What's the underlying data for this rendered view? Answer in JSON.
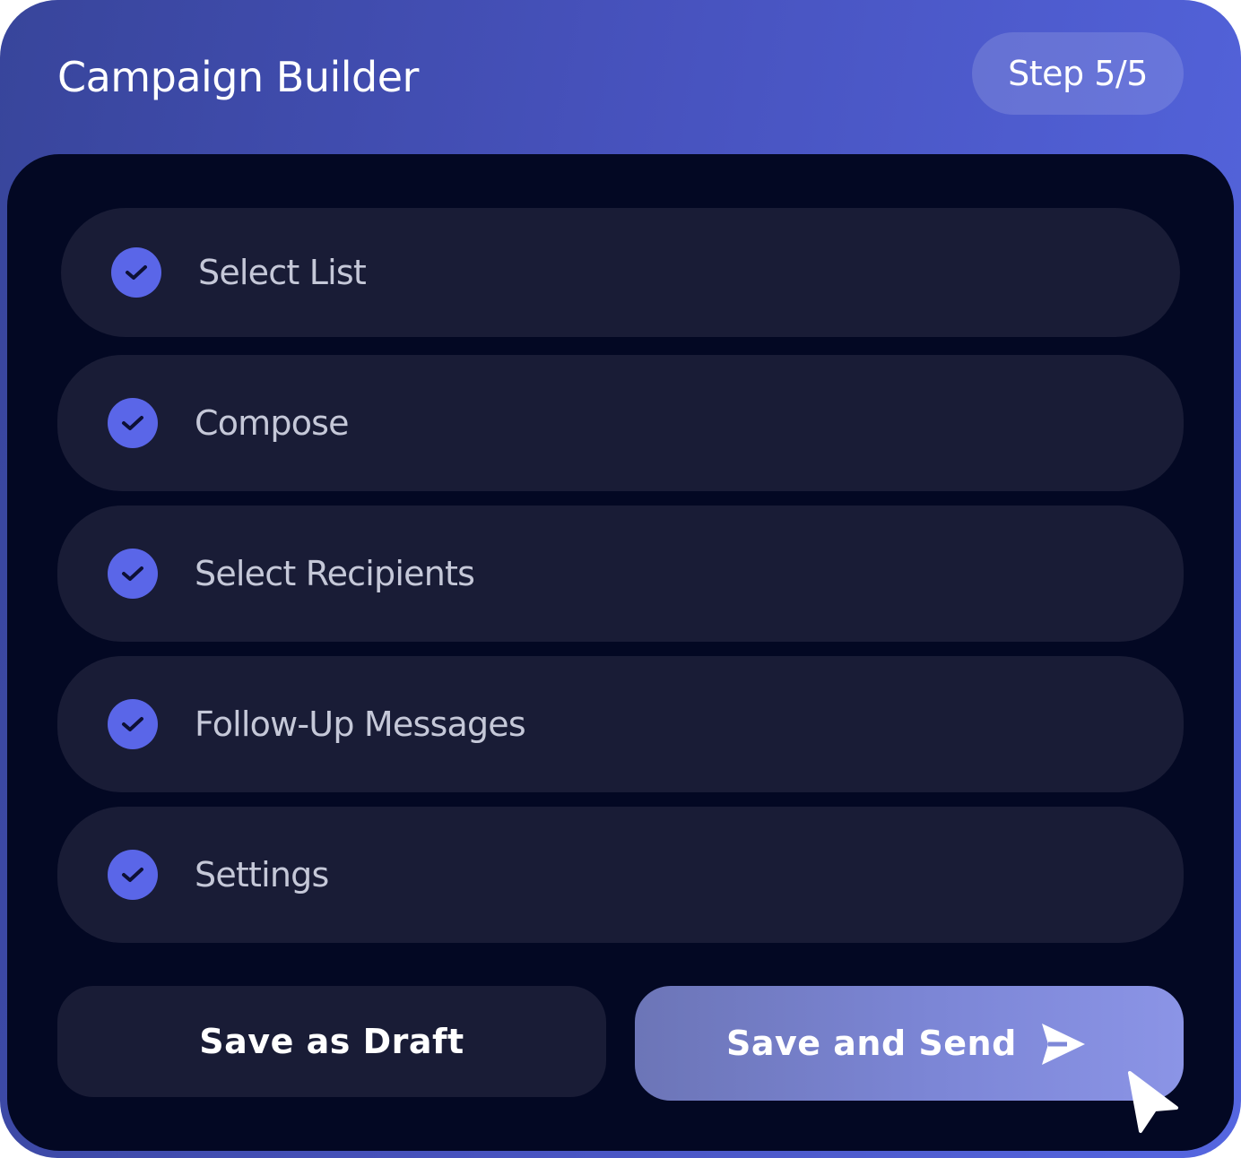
{
  "header": {
    "title": "Campaign Builder",
    "step_indicator": "Step 5/5"
  },
  "steps": [
    {
      "label": "Select List",
      "completed": true
    },
    {
      "label": "Compose",
      "completed": true
    },
    {
      "label": "Select Recipients",
      "completed": true
    },
    {
      "label": "Follow-Up Messages",
      "completed": true
    },
    {
      "label": "Settings",
      "completed": true
    }
  ],
  "actions": {
    "draft_label": "Save as Draft",
    "send_label": "Save and Send"
  },
  "icons": {
    "step_status": "check-circle-icon",
    "send": "send-icon",
    "pointer": "cursor-icon"
  },
  "colors": {
    "accent": "#5a66e8",
    "panel_background": "#030823",
    "row_background": "#191c36"
  }
}
